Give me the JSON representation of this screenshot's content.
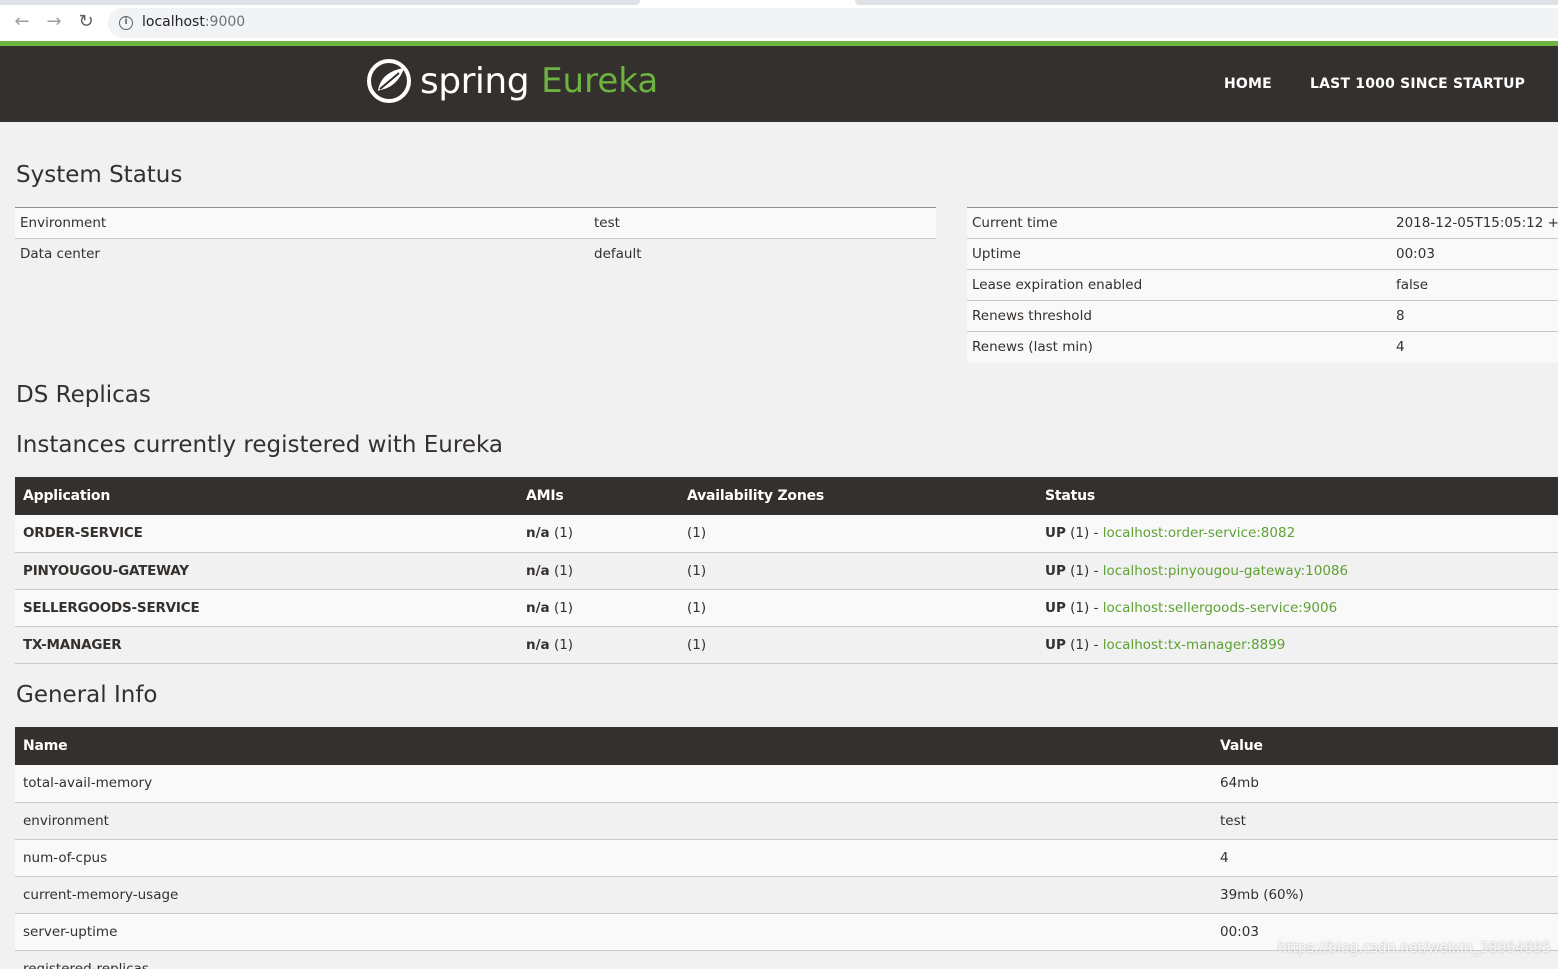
{
  "browser": {
    "url_host": "localhost",
    "url_port": ":9000"
  },
  "header": {
    "logo_word": "spring",
    "logo_product": "Eureka",
    "nav": {
      "home": "HOME",
      "last": "LAST 1000 SINCE STARTUP"
    }
  },
  "system_status": {
    "title": "System Status",
    "left": [
      {
        "label": "Environment",
        "value": "test"
      },
      {
        "label": "Data center",
        "value": "default"
      }
    ],
    "right": [
      {
        "label": "Current time",
        "value": "2018-12-05T15:05:12 +"
      },
      {
        "label": "Uptime",
        "value": "00:03"
      },
      {
        "label": "Lease expiration enabled",
        "value": "false"
      },
      {
        "label": "Renews threshold",
        "value": "8"
      },
      {
        "label": "Renews (last min)",
        "value": "4"
      }
    ]
  },
  "ds_replicas": {
    "title": "DS Replicas"
  },
  "instances": {
    "title": "Instances currently registered with Eureka",
    "columns": [
      "Application",
      "AMIs",
      "Availability Zones",
      "Status"
    ],
    "rows": [
      {
        "app": "ORDER-SERVICE",
        "ami_label": "n/a",
        "ami_count": "(1)",
        "zones": "(1)",
        "status": "UP",
        "status_count": "(1) -",
        "link": "localhost:order-service:8082"
      },
      {
        "app": "PINYOUGOU-GATEWAY",
        "ami_label": "n/a",
        "ami_count": "(1)",
        "zones": "(1)",
        "status": "UP",
        "status_count": "(1) -",
        "link": "localhost:pinyougou-gateway:10086"
      },
      {
        "app": "SELLERGOODS-SERVICE",
        "ami_label": "n/a",
        "ami_count": "(1)",
        "zones": "(1)",
        "status": "UP",
        "status_count": "(1) -",
        "link": "localhost:sellergoods-service:9006"
      },
      {
        "app": "TX-MANAGER",
        "ami_label": "n/a",
        "ami_count": "(1)",
        "zones": "(1)",
        "status": "UP",
        "status_count": "(1) -",
        "link": "localhost:tx-manager:8899"
      }
    ]
  },
  "general_info": {
    "title": "General Info",
    "columns": [
      "Name",
      "Value"
    ],
    "rows": [
      {
        "name": "total-avail-memory",
        "value": "64mb"
      },
      {
        "name": "environment",
        "value": "test"
      },
      {
        "name": "num-of-cpus",
        "value": "4"
      },
      {
        "name": "current-memory-usage",
        "value": "39mb (60%)"
      },
      {
        "name": "server-uptime",
        "value": "00:03"
      },
      {
        "name": "registered-replicas",
        "value": ""
      }
    ]
  },
  "watermark": "https://blog.csdn.net/weixin_38964895",
  "colors": {
    "brand_green": "#6db33f",
    "header_dark": "#34302d",
    "link_green": "#5fa134"
  }
}
